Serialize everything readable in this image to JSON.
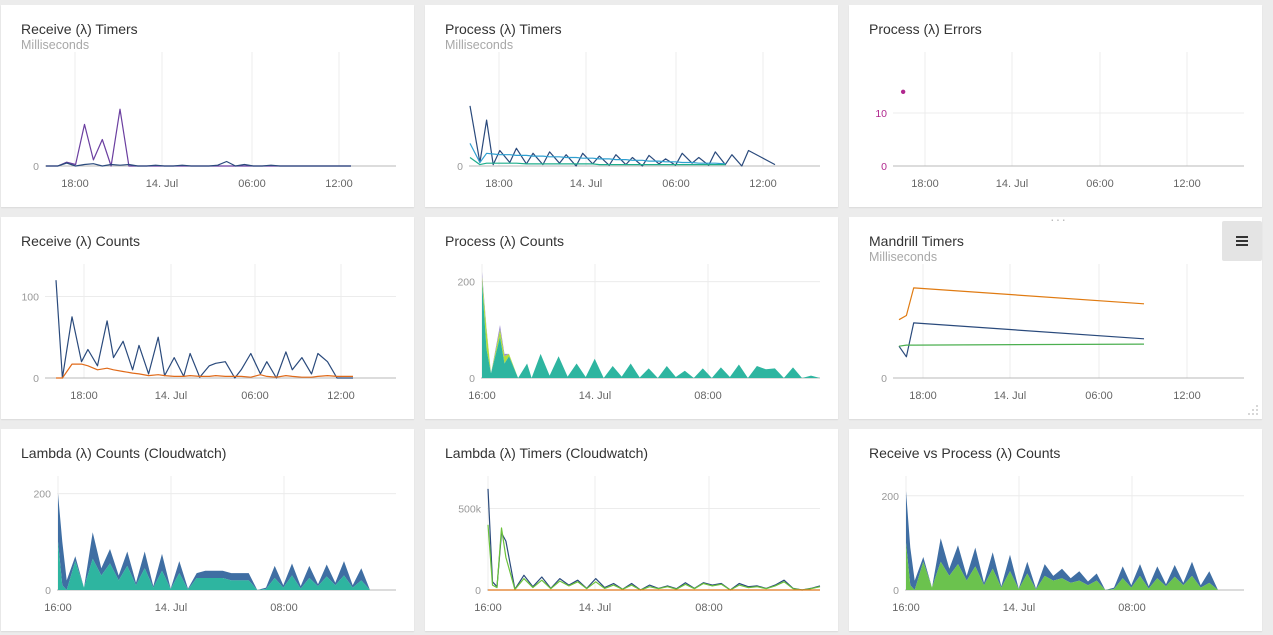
{
  "dashboard": {
    "panel_menu_label": "≡",
    "drag_label": "···"
  },
  "chart_data": [
    {
      "type": "line",
      "title": "Receive (λ) Timers",
      "subtitle": "Milliseconds",
      "x_ticks": [
        "18:00",
        "14. Jul",
        "06:00",
        "12:00"
      ],
      "y_ticks": [
        "0"
      ],
      "ylim": [
        0,
        140
      ],
      "grid": "vertical",
      "x": [
        0,
        4,
        7,
        10,
        13,
        16,
        19,
        22,
        25,
        28,
        31,
        34,
        37,
        40,
        43,
        46,
        49,
        52,
        55,
        58,
        61,
        64,
        67,
        70,
        73,
        76,
        79,
        82,
        85,
        88,
        91,
        94,
        97,
        100,
        103
      ],
      "series": [
        {
          "color": "#6b3fa0",
          "values": [
            0,
            0,
            5,
            2,
            55,
            8,
            35,
            0,
            75,
            0,
            0,
            0,
            0,
            0,
            0,
            0,
            0,
            0,
            0,
            0,
            0,
            0,
            0,
            0,
            0,
            0,
            0,
            0,
            0,
            0,
            0,
            0,
            0,
            0,
            0
          ]
        },
        {
          "color": "#2a4a7c",
          "values": [
            0,
            0,
            4,
            0,
            2,
            3,
            0,
            2,
            1,
            2,
            0,
            0,
            1,
            0,
            0,
            1,
            0,
            0,
            0,
            1,
            6,
            0,
            2,
            0,
            0,
            1,
            0,
            0,
            0,
            0,
            0,
            0,
            0,
            0,
            0
          ]
        }
      ]
    },
    {
      "type": "line",
      "title": "Process (λ) Timers",
      "subtitle": "Milliseconds",
      "x_ticks": [
        "18:00",
        "14. Jul",
        "06:00",
        "12:00"
      ],
      "y_ticks": [
        "0"
      ],
      "ylim": [
        0,
        150
      ],
      "grid": "vertical",
      "x": [
        0,
        3,
        5,
        7,
        9,
        12,
        14,
        17,
        19,
        22,
        24,
        27,
        29,
        32,
        34,
        37,
        39,
        42,
        44,
        47,
        49,
        52,
        54,
        57,
        59,
        62,
        64,
        67,
        69,
        72,
        74,
        77,
        79,
        82,
        84,
        88,
        92
      ],
      "series": [
        {
          "color": "#2a4a7c",
          "values": [
            85,
            5,
            65,
            2,
            22,
            5,
            25,
            3,
            18,
            2,
            20,
            4,
            16,
            0,
            18,
            3,
            14,
            1,
            16,
            2,
            12,
            0,
            15,
            3,
            10,
            1,
            18,
            4,
            12,
            1,
            20,
            2,
            16,
            0,
            22,
            12,
            2
          ]
        },
        {
          "color": "#2f9fd0",
          "values": [
            32,
            5,
            18,
            17,
            16,
            16,
            15,
            15,
            14,
            14,
            13,
            13,
            12,
            12,
            11,
            11,
            10,
            10,
            9,
            9,
            8,
            8,
            7,
            7,
            6,
            6,
            5,
            5,
            4,
            4,
            4,
            3,
            null,
            null,
            null,
            null,
            null
          ]
        },
        {
          "color": "#1fae8c",
          "values": [
            12,
            2,
            4,
            4,
            4,
            4,
            4,
            3,
            3,
            3,
            3,
            3,
            3,
            3,
            3,
            3,
            2,
            2,
            2,
            2,
            2,
            2,
            2,
            2,
            2,
            2,
            2,
            2,
            2,
            2,
            2,
            2,
            null,
            null,
            null,
            null,
            null
          ]
        }
      ]
    },
    {
      "type": "scatter",
      "title": "Process (λ) Errors",
      "subtitle": "",
      "x_ticks": [
        "18:00",
        "14. Jul",
        "06:00",
        "12:00"
      ],
      "y_ticks": [
        "0",
        "10"
      ],
      "ylim": [
        0,
        20
      ],
      "grid": "both",
      "series": [
        {
          "color": "#b0278e",
          "points": [
            [
              3,
              14
            ]
          ]
        }
      ]
    },
    {
      "type": "line",
      "title": "Receive (λ) Counts",
      "subtitle": "",
      "x_ticks": [
        "18:00",
        "14. Jul",
        "06:00",
        "12:00"
      ],
      "y_ticks": [
        "0",
        "100"
      ],
      "ylim": [
        0,
        130
      ],
      "grid": "both",
      "x": [
        0,
        2,
        5,
        8,
        10,
        13,
        16,
        18,
        21,
        24,
        26,
        29,
        32,
        34,
        37,
        40,
        42,
        45,
        48,
        50,
        53,
        56,
        58,
        61,
        64,
        66,
        69,
        72,
        74,
        77,
        80,
        82,
        85,
        88,
        90,
        92,
        93
      ],
      "series": [
        {
          "color": "#2a4a7c",
          "values": [
            120,
            0,
            75,
            20,
            35,
            15,
            70,
            25,
            45,
            10,
            40,
            5,
            50,
            3,
            25,
            2,
            30,
            1,
            15,
            18,
            20,
            0,
            10,
            30,
            5,
            20,
            0,
            32,
            10,
            25,
            5,
            30,
            20,
            0,
            0,
            0,
            0
          ]
        },
        {
          "color": "#e06a19",
          "values": [
            0,
            0,
            17,
            17,
            15,
            10,
            12,
            10,
            8,
            6,
            5,
            3,
            4,
            3,
            2,
            2,
            3,
            2,
            2,
            3,
            2,
            2,
            2,
            1,
            4,
            2,
            1,
            3,
            2,
            1,
            1,
            2,
            3,
            2,
            2,
            2,
            2
          ]
        }
      ]
    },
    {
      "type": "area",
      "title": "Process (λ) Counts",
      "subtitle": "",
      "x_ticks": [
        "16:00",
        "14. Jul",
        "08:00"
      ],
      "y_ticks": [
        "0",
        "200"
      ],
      "ylim": [
        0,
        220
      ],
      "grid": "both",
      "stacked": true,
      "x": [
        0,
        1,
        2,
        4,
        5,
        6,
        8,
        10,
        11,
        13,
        15,
        17,
        19,
        21,
        23,
        25,
        27,
        29,
        31,
        33,
        35,
        37,
        39,
        41,
        43,
        45,
        47,
        49,
        51,
        53,
        55,
        57,
        59,
        61,
        63,
        65,
        67,
        69,
        71,
        73,
        75
      ],
      "series": [
        {
          "color": "#2eb5a0",
          "values": [
            200,
            60,
            10,
            85,
            30,
            45,
            0,
            30,
            0,
            50,
            5,
            45,
            3,
            30,
            2,
            40,
            0,
            25,
            3,
            30,
            1,
            20,
            0,
            25,
            2,
            15,
            0,
            20,
            0,
            22,
            2,
            28,
            0,
            25,
            18,
            20,
            0,
            22,
            0,
            5,
            0
          ]
        },
        {
          "color": "#b3de3a",
          "values": [
            10,
            40,
            0,
            15,
            15,
            5,
            0,
            0,
            0,
            0,
            0,
            0,
            0,
            0,
            0,
            0,
            0,
            0,
            0,
            0,
            0,
            0,
            0,
            0,
            0,
            0,
            0,
            0,
            0,
            0,
            0,
            0,
            0,
            0,
            0,
            0,
            0,
            0,
            0,
            0,
            0
          ]
        },
        {
          "color": "#9a8ccf",
          "values": [
            10,
            5,
            0,
            10,
            5,
            0,
            0,
            0,
            0,
            0,
            0,
            0,
            0,
            0,
            0,
            0,
            0,
            0,
            0,
            0,
            0,
            0,
            0,
            0,
            0,
            0,
            0,
            0,
            0,
            0,
            0,
            0,
            0,
            0,
            0,
            0,
            0,
            0,
            0,
            0,
            0
          ]
        }
      ]
    },
    {
      "type": "line",
      "title": "Mandrill Timers",
      "subtitle": "Milliseconds",
      "x_ticks": [
        "18:00",
        "14. Jul",
        "06:00",
        "12:00"
      ],
      "y_ticks": [
        "0"
      ],
      "ylim": [
        0,
        100
      ],
      "grid": "vertical",
      "x": [
        0,
        3,
        6,
        100
      ],
      "series": [
        {
          "color": "#e07b12",
          "values": [
            55,
            59,
            85,
            70
          ]
        },
        {
          "color": "#2a4a7c",
          "values": [
            30,
            20,
            52,
            37
          ]
        },
        {
          "color": "#4caf50",
          "values": [
            30,
            31,
            31,
            32
          ]
        }
      ]
    },
    {
      "type": "area",
      "title": "Lambda (λ) Counts (Cloudwatch)",
      "subtitle": "",
      "x_ticks": [
        "16:00",
        "14. Jul",
        "08:00"
      ],
      "y_ticks": [
        "0",
        "200"
      ],
      "ylim": [
        0,
        220
      ],
      "grid": "both",
      "stacked": true,
      "x": [
        0,
        1,
        2,
        4,
        6,
        8,
        10,
        12,
        14,
        16,
        18,
        20,
        22,
        24,
        26,
        28,
        30,
        32,
        34,
        36,
        38,
        40,
        42,
        44,
        46,
        48,
        50,
        52,
        54,
        56,
        58,
        60,
        62,
        64,
        66,
        68,
        70,
        72,
        74,
        76,
        78
      ],
      "series": [
        {
          "color": "#2eb5a0",
          "values": [
            100,
            10,
            0,
            60,
            5,
            65,
            30,
            55,
            20,
            50,
            10,
            45,
            5,
            40,
            2,
            35,
            1,
            25,
            25,
            25,
            25,
            20,
            20,
            20,
            0,
            2,
            25,
            5,
            30,
            3,
            25,
            8,
            28,
            10,
            30,
            5,
            20,
            0,
            0,
            0,
            0
          ]
        },
        {
          "color": "#3f6ea3",
          "values": [
            100,
            90,
            20,
            10,
            0,
            55,
            15,
            30,
            10,
            30,
            5,
            35,
            3,
            35,
            1,
            25,
            2,
            10,
            15,
            15,
            15,
            15,
            15,
            15,
            0,
            3,
            25,
            5,
            25,
            5,
            25,
            4,
            25,
            5,
            30,
            5,
            25,
            0,
            0,
            0,
            0
          ]
        }
      ]
    },
    {
      "type": "line",
      "title": "Lambda (λ) Timers (Cloudwatch)",
      "subtitle": "",
      "x_ticks": [
        "16:00",
        "14. Jul",
        "08:00"
      ],
      "y_ticks": [
        "0",
        "500k"
      ],
      "ylim": [
        0,
        650000
      ],
      "grid": "both",
      "x": [
        0,
        1,
        2,
        3,
        4,
        6,
        8,
        10,
        12,
        14,
        16,
        18,
        20,
        22,
        24,
        26,
        28,
        30,
        32,
        34,
        36,
        38,
        40,
        42,
        44,
        46,
        48,
        50,
        52,
        54,
        56,
        58,
        60,
        62,
        64,
        66,
        68,
        70,
        72,
        74
      ],
      "series": [
        {
          "color": "#2a4a7c",
          "values": [
            620000,
            50000,
            20000,
            350000,
            300000,
            5000,
            90000,
            20000,
            80000,
            10000,
            70000,
            30000,
            60000,
            10000,
            70000,
            15000,
            40000,
            5000,
            40000,
            0,
            30000,
            10000,
            25000,
            8000,
            45000,
            10000,
            45000,
            30000,
            40000,
            0,
            40000,
            20000,
            25000,
            10000,
            30000,
            60000,
            10000,
            0,
            10000,
            25000
          ]
        },
        {
          "color": "#6bc23a",
          "values": [
            400000,
            30000,
            15000,
            380000,
            200000,
            3000,
            70000,
            15000,
            60000,
            8000,
            55000,
            25000,
            50000,
            8000,
            50000,
            10000,
            30000,
            4000,
            30000,
            0,
            20000,
            8000,
            20000,
            5000,
            35000,
            8000,
            40000,
            25000,
            35000,
            0,
            30000,
            15000,
            20000,
            8000,
            25000,
            50000,
            8000,
            0,
            8000,
            20000
          ]
        },
        {
          "color": "#e0761a",
          "values": [
            0,
            0,
            0,
            0,
            0,
            0,
            0,
            0,
            0,
            0,
            0,
            0,
            0,
            0,
            0,
            0,
            0,
            0,
            0,
            0,
            0,
            0,
            0,
            0,
            0,
            0,
            0,
            0,
            0,
            0,
            0,
            0,
            0,
            0,
            0,
            0,
            0,
            0,
            0,
            0
          ]
        }
      ]
    },
    {
      "type": "area",
      "title": "Receive vs Process (λ) Counts",
      "subtitle": "",
      "x_ticks": [
        "16:00",
        "14. Jul",
        "08:00"
      ],
      "y_ticks": [
        "0",
        "200"
      ],
      "ylim": [
        0,
        225
      ],
      "grid": "both",
      "stacked": true,
      "x": [
        0,
        1,
        2,
        4,
        6,
        8,
        10,
        12,
        14,
        16,
        18,
        20,
        22,
        24,
        26,
        28,
        30,
        32,
        34,
        36,
        38,
        40,
        42,
        44,
        46,
        48,
        50,
        52,
        54,
        56,
        58,
        60,
        62,
        64,
        66,
        68,
        70,
        72,
        74,
        76,
        78
      ],
      "series": [
        {
          "color": "#6bc24e",
          "values": [
            100,
            10,
            0,
            60,
            5,
            60,
            30,
            55,
            20,
            50,
            10,
            45,
            5,
            40,
            2,
            35,
            1,
            30,
            20,
            25,
            15,
            20,
            10,
            20,
            0,
            2,
            25,
            5,
            30,
            3,
            25,
            8,
            28,
            10,
            30,
            5,
            15,
            0,
            0,
            0,
            0
          ]
        },
        {
          "color": "#3f6ea3",
          "values": [
            110,
            80,
            20,
            10,
            0,
            50,
            15,
            40,
            10,
            40,
            5,
            35,
            3,
            35,
            1,
            25,
            2,
            25,
            10,
            20,
            10,
            20,
            8,
            15,
            0,
            3,
            25,
            5,
            25,
            5,
            25,
            4,
            25,
            5,
            30,
            5,
            25,
            0,
            0,
            0,
            0
          ]
        }
      ]
    }
  ]
}
